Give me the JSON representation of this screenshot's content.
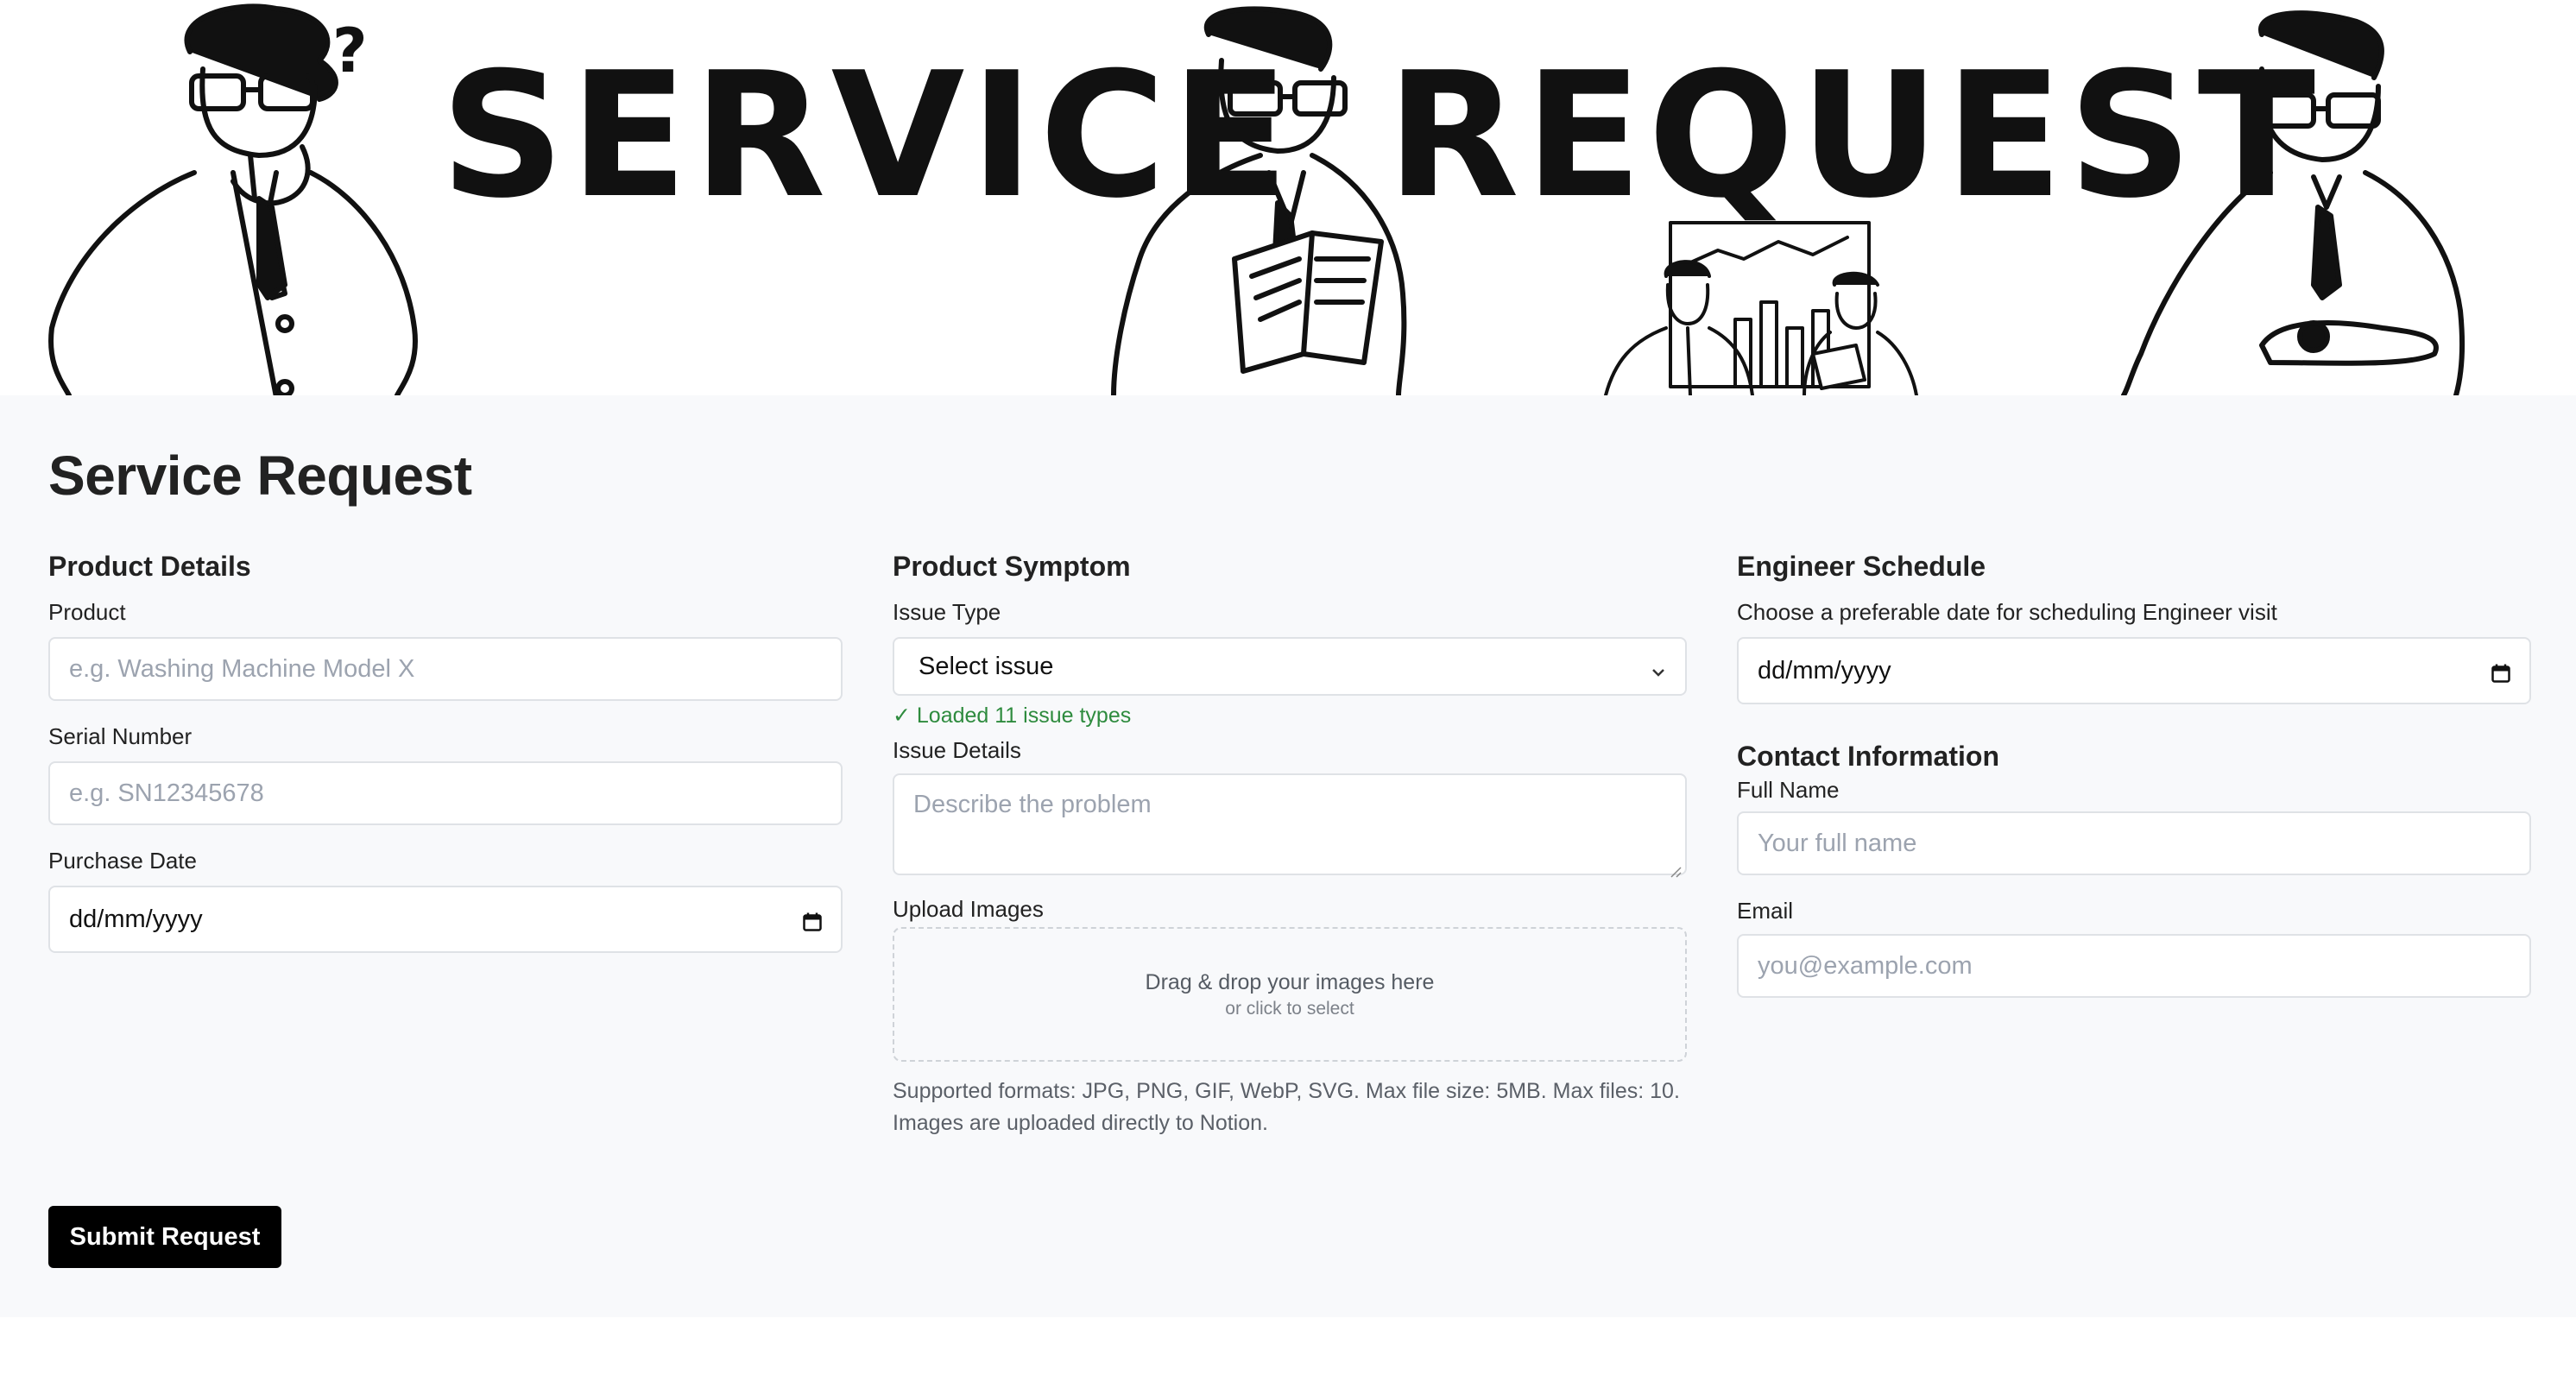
{
  "banner": {
    "word_left": "SERVICE",
    "word_right": "REQUEST",
    "question_mark": "?"
  },
  "page_title": "Service Request",
  "product_details": {
    "heading": "Product Details",
    "product_label": "Product",
    "product_placeholder": "e.g. Washing Machine Model X",
    "serial_label": "Serial Number",
    "serial_placeholder": "e.g. SN12345678",
    "purchase_label": "Purchase Date",
    "purchase_value": "dd/mm/yyyy"
  },
  "product_symptom": {
    "heading": "Product Symptom",
    "issue_type_label": "Issue Type",
    "issue_type_selected": "Select issue",
    "status": "✓ Loaded 11 issue types",
    "issue_details_label": "Issue Details",
    "issue_details_placeholder": "Describe the problem",
    "upload_label": "Upload Images",
    "dropzone_main": "Drag & drop your images here",
    "dropzone_sub": "or click to select",
    "help_text": "Supported formats: JPG, PNG, GIF, WebP, SVG. Max file size: 5MB. Max files: 10. Images are uploaded directly to Notion."
  },
  "engineer_schedule": {
    "heading": "Engineer Schedule",
    "date_label": "Choose a preferable date for scheduling Engineer visit",
    "date_value": "dd/mm/yyyy"
  },
  "contact": {
    "heading": "Contact Information",
    "name_label": "Full Name",
    "name_placeholder": "Your full name",
    "email_label": "Email",
    "email_placeholder": "you@example.com"
  },
  "submit_label": "Submit Request",
  "icons": {
    "calendar": "calendar-icon",
    "chevron": "chevron-down-icon",
    "resize": "resize-handle-icon"
  },
  "colors": {
    "accent_button": "#000000",
    "success": "#2e8b3e",
    "panel_bg": "#f8f9fb"
  }
}
